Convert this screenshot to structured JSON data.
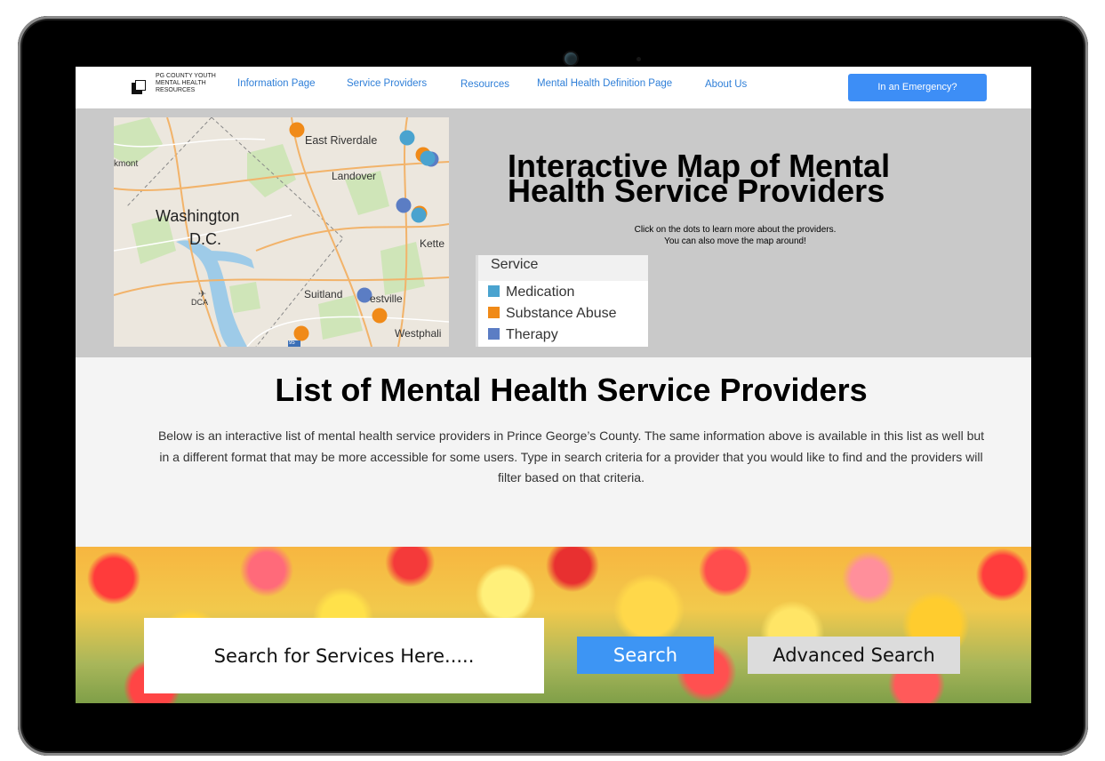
{
  "header": {
    "logo_text": "PG COUNTY YOUTH MENTAL HEALTH RESOURCES",
    "nav": [
      {
        "label": "Information Page"
      },
      {
        "label": "Service Providers"
      },
      {
        "label": "Resources"
      },
      {
        "label": "Mental Health Definition Page"
      },
      {
        "label": "About Us"
      }
    ],
    "emergency_label": "In an Emergency?"
  },
  "map_section": {
    "title": "Interactive Map of Mental Health Service Providers",
    "subtitle_line1": "Click on the dots to learn more about the providers.",
    "subtitle_line2": "You can also move the map around!",
    "map_labels": {
      "east_riverdale": "East Riverdale",
      "landover": "Landover",
      "washington": "Washington",
      "dc": "D.C.",
      "kmont": "kmont",
      "suitland": "Suitland",
      "forestville": "estville",
      "kettering": "Kette",
      "westphalia": "Westphali",
      "dca": "DCA",
      "route": "95"
    },
    "legend": {
      "title": "Service",
      "items": [
        {
          "label": "Medication",
          "color": "#4aa3cf"
        },
        {
          "label": "Substance Abuse",
          "color": "#f08a18"
        },
        {
          "label": "Therapy",
          "color": "#5b7dc4"
        }
      ]
    }
  },
  "list_section": {
    "title": "List of Mental Health Service Providers",
    "description": "Below is an interactive list of mental health service providers in Prince George’s County. The same information above is available in this list as well but in a different format that may be more accessible for some users. Type in search criteria for a provider that you would like to find and the providers will filter based on that criteria."
  },
  "search": {
    "placeholder": "Search for Services Here.....",
    "search_label": "Search",
    "advanced_label": "Advanced Search"
  },
  "colors": {
    "accent": "#3d8ef6",
    "nav_link": "#2f7fd8",
    "map_band": "#c9c9c9"
  }
}
